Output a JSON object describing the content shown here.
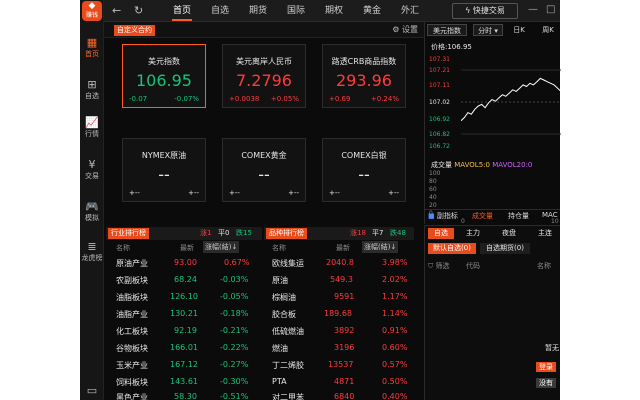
{
  "rail": {
    "logo_text": "赚钱",
    "items": [
      {
        "label": "首页",
        "icon": "grid-icon"
      },
      {
        "label": "自选",
        "icon": "plus-box-icon"
      },
      {
        "label": "行情",
        "icon": "chart-icon"
      },
      {
        "label": "交易",
        "icon": "yen-icon"
      },
      {
        "label": "模拟",
        "icon": "gamepad-icon"
      },
      {
        "label": "龙虎榜",
        "icon": "database-icon"
      }
    ]
  },
  "nav": {
    "tabs": [
      "首页",
      "自选",
      "期货",
      "国际",
      "期权",
      "黄金",
      "外汇"
    ],
    "active": "首页",
    "quick_trade": "快捷交易"
  },
  "board": {
    "custom_label": "自定义合约",
    "settings_label": "设置"
  },
  "cards": [
    {
      "name": "美元指数",
      "value": "106.95",
      "change": "-0.07",
      "pct": "-0.07%",
      "color": "green"
    },
    {
      "name": "美元离岸人民币",
      "value": "7.2796",
      "change": "+0.0038",
      "pct": "+0.05%",
      "color": "red"
    },
    {
      "name": "路透CRB商品指数",
      "value": "293.96",
      "change": "+0.69",
      "pct": "+0.24%",
      "color": "red"
    },
    {
      "name": "NYMEX原油",
      "value": "--",
      "change": "+--",
      "pct": "+--",
      "color": "white"
    },
    {
      "name": "COMEX黄金",
      "value": "--",
      "change": "+--",
      "pct": "+--",
      "color": "white"
    },
    {
      "name": "COMEX白银",
      "value": "--",
      "change": "+--",
      "pct": "+--",
      "color": "white"
    }
  ],
  "industry": {
    "title": "行业排行榜",
    "up_label": "涨1",
    "flat_label": "平0",
    "down_label": "跌15",
    "col_name": "名称",
    "col_latest": "最新",
    "col_change": "涨幅(結)↓",
    "rows": [
      {
        "name": "原油产业",
        "latest": "93.00",
        "pct": "0.67%",
        "color": "red"
      },
      {
        "name": "农副板块",
        "latest": "68.24",
        "pct": "-0.03%",
        "color": "green"
      },
      {
        "name": "油脂板块",
        "latest": "126.10",
        "pct": "-0.05%",
        "color": "green"
      },
      {
        "name": "油脂产业",
        "latest": "130.21",
        "pct": "-0.18%",
        "color": "green"
      },
      {
        "name": "化工板块",
        "latest": "92.19",
        "pct": "-0.21%",
        "color": "green"
      },
      {
        "name": "谷物板块",
        "latest": "166.01",
        "pct": "-0.22%",
        "color": "green"
      },
      {
        "name": "玉米产业",
        "latest": "167.12",
        "pct": "-0.27%",
        "color": "green"
      },
      {
        "name": "饲料板块",
        "latest": "143.61",
        "pct": "-0.30%",
        "color": "green"
      },
      {
        "name": "黑色产业",
        "latest": "58.30",
        "pct": "-0.51%",
        "color": "green"
      }
    ]
  },
  "products": {
    "title": "品种排行榜",
    "up_label": "涨18",
    "flat_label": "平7",
    "down_label": "跌48",
    "col_name": "名称",
    "col_latest": "最新",
    "col_change": "涨幅(結)↓",
    "rows": [
      {
        "name": "欧线集运",
        "latest": "2040.8",
        "pct": "3.98%"
      },
      {
        "name": "原油",
        "latest": "549.3",
        "pct": "2.02%"
      },
      {
        "name": "棕榈油",
        "latest": "9591",
        "pct": "1.17%"
      },
      {
        "name": "胶合板",
        "latest": "189.68",
        "pct": "1.14%"
      },
      {
        "name": "低硫燃油",
        "latest": "3892",
        "pct": "0.91%"
      },
      {
        "name": "燃油",
        "latest": "3196",
        "pct": "0.60%"
      },
      {
        "name": "丁二烯胶",
        "latest": "13537",
        "pct": "0.57%"
      },
      {
        "name": "PTA",
        "latest": "4871",
        "pct": "0.50%"
      },
      {
        "name": "对二甲苯",
        "latest": "6840",
        "pct": "0.40%"
      }
    ]
  },
  "chart_panel": {
    "title": "美元指数",
    "period": "分时",
    "k_day": "日K",
    "k_week": "周K",
    "price_label": "价格:106.95",
    "y_ticks": [
      "107.31",
      "107.21",
      "107.11",
      "107.02",
      "106.92",
      "106.82",
      "106.72"
    ],
    "volume_label": "成交量",
    "mavol5": "MAVOL5:0",
    "mavol20": "MAVOL20:0",
    "vol_ticks": [
      "100",
      "80",
      "60",
      "40",
      "20",
      "0"
    ],
    "x_ticks": [
      "0",
      "10"
    ],
    "bottom_tabs": [
      "副指标",
      "成交量",
      "持仓量",
      "MAC"
    ]
  },
  "chart_data": {
    "type": "line",
    "title": "",
    "xlabel": "",
    "ylabel": "",
    "ylim": [
      106.72,
      107.31
    ],
    "y": [
      106.9,
      106.92,
      106.95,
      106.94,
      106.97,
      106.99,
      107.0,
      106.98,
      107.01,
      107.03,
      107.02,
      107.04,
      107.06,
      107.05,
      107.07,
      107.09,
      107.08,
      107.1,
      107.12,
      107.11,
      107.13,
      107.12,
      107.14,
      107.16,
      107.15,
      107.14,
      107.13,
      107.12,
      107.1,
      107.08
    ]
  },
  "watch": {
    "tabs": [
      "自选",
      "主力",
      "夜盘",
      "主连"
    ],
    "subtabs": [
      "默认自选(0)",
      "自选期货(0)"
    ],
    "filter_label": "筛选",
    "col_code": "代码",
    "col_name": "名称",
    "empty_text": "暂无",
    "login_label": "登录",
    "noacct_label": "没有"
  }
}
